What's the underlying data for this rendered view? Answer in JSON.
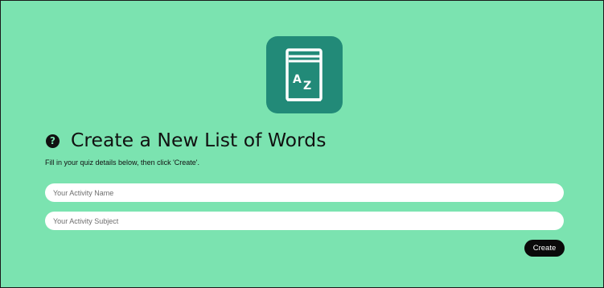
{
  "app": {
    "title": "Create a New List of Words",
    "instructions": "Fill in your quiz details below, then click 'Create'.",
    "help_icon_glyph": "?"
  },
  "logo": {
    "icon": "book-az-icon",
    "letter_a": "A",
    "letter_z": "Z",
    "tile_color": "#228a78"
  },
  "form": {
    "activity_name": {
      "value": "",
      "placeholder": "Your Activity Name"
    },
    "activity_subject": {
      "value": "",
      "placeholder": "Your Activity Subject"
    },
    "create_label": "Create"
  },
  "colors": {
    "background": "#7be3b0",
    "button": "#0a0a0a",
    "text": "#111111"
  }
}
